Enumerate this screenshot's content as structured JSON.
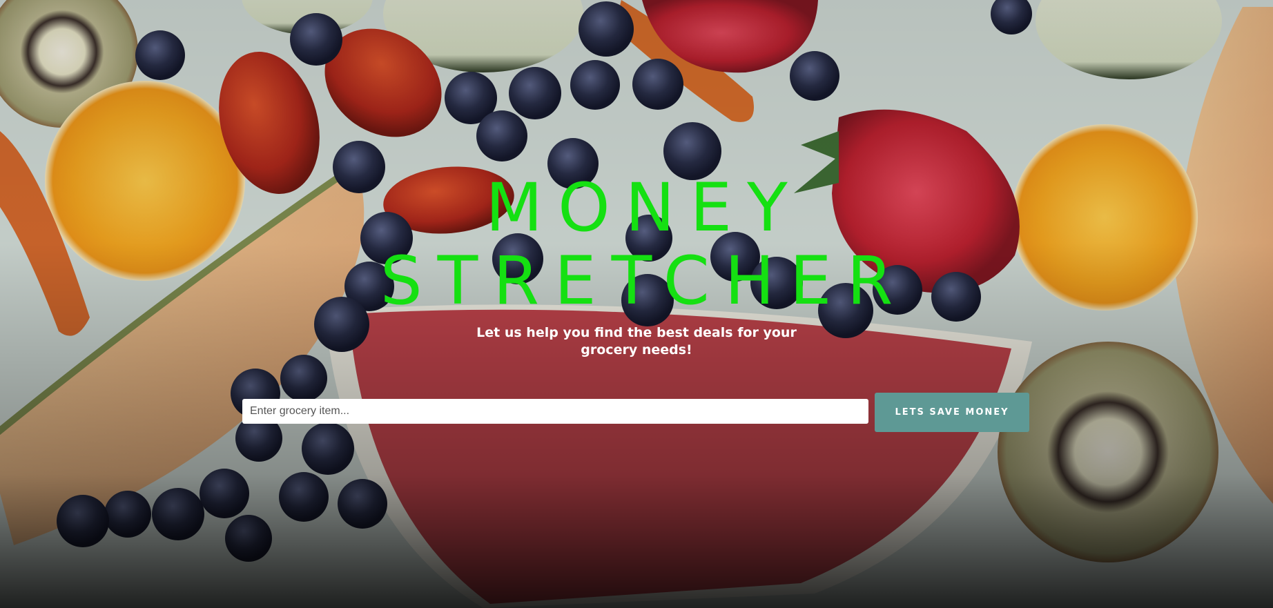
{
  "hero": {
    "title_line1": "MONEY",
    "title_line2": "STRETCHER",
    "subtitle": "Let us help you find the best deals for your grocery needs!"
  },
  "search": {
    "value": "",
    "placeholder": "Enter grocery item..."
  },
  "action": {
    "button_label": "LETS SAVE MONEY"
  },
  "colors": {
    "title": "#15e012",
    "button": "#5e9995",
    "subtitle": "#ffffff"
  }
}
